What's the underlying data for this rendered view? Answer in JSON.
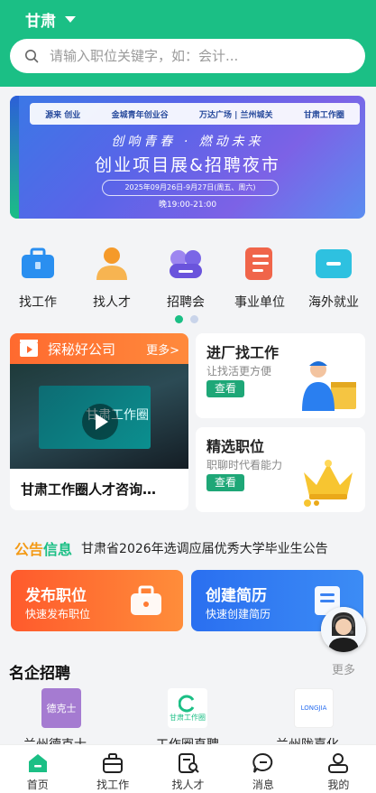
{
  "header": {
    "city": "甘肃",
    "search_placeholder": "请输入职位关键字，如：会计..."
  },
  "banner": {
    "logos": [
      "源来 创业",
      "金城青年创业谷",
      "万达广场 | 兰州城关",
      "甘肃工作圈"
    ],
    "slogan": "创响青春 · 燃动未来",
    "title": "创业项目展&招聘夜市",
    "date": "2025年09月26日-9月27日(周五、周六)",
    "time": "晚19:00-21:00"
  },
  "categories": [
    {
      "label": "找工作",
      "icon": "briefcase-icon",
      "color": "#2a8ff0"
    },
    {
      "label": "找人才",
      "icon": "person-icon",
      "color": "#f59a2a"
    },
    {
      "label": "招聘会",
      "icon": "group-icon",
      "color": "#7a66e6"
    },
    {
      "label": "事业单位",
      "icon": "document-icon",
      "color": "#f0654a"
    },
    {
      "label": "海外就业",
      "icon": "globe-icon",
      "color": "#2ec1e0"
    }
  ],
  "explore": {
    "title": "探秘好公司",
    "more": "更多>",
    "caption": "甘肃工作圈人才咨询…",
    "screen_text": "甘肃工作圈"
  },
  "factory_card": {
    "title": "进厂找工作",
    "subtitle": "让找活更方便",
    "button": "查看"
  },
  "select_card": {
    "title": "精选职位",
    "subtitle": "职聊时代看能力",
    "button": "查看"
  },
  "notice": {
    "tag1": "公告",
    "tag2": "信息",
    "text": "甘肃省2026年选调应届优秀大学毕业生公告"
  },
  "post_job": {
    "title": "发布职位",
    "subtitle": "快速发布职位"
  },
  "create_resume": {
    "title": "创建简历",
    "subtitle": "快速创建简历"
  },
  "famous": {
    "title": "名企招聘",
    "more": "更多",
    "companies": [
      {
        "name": "兰州德克士…",
        "logo_text": "德克士"
      },
      {
        "name": "工作圈直聘",
        "logo_text": "甘肃工作圈"
      },
      {
        "name": "兰州陇嘉化…",
        "logo_text": "LONGJIA"
      }
    ]
  },
  "tabs": [
    {
      "label": "首页",
      "icon": "home-icon"
    },
    {
      "label": "找工作",
      "icon": "briefcase-icon"
    },
    {
      "label": "找人才",
      "icon": "resume-search-icon"
    },
    {
      "label": "消息",
      "icon": "message-icon"
    },
    {
      "label": "我的",
      "icon": "user-icon"
    }
  ],
  "colors": {
    "primary": "#1bbf85",
    "orange": "#ff6a2f",
    "blue": "#2a7ff0"
  }
}
